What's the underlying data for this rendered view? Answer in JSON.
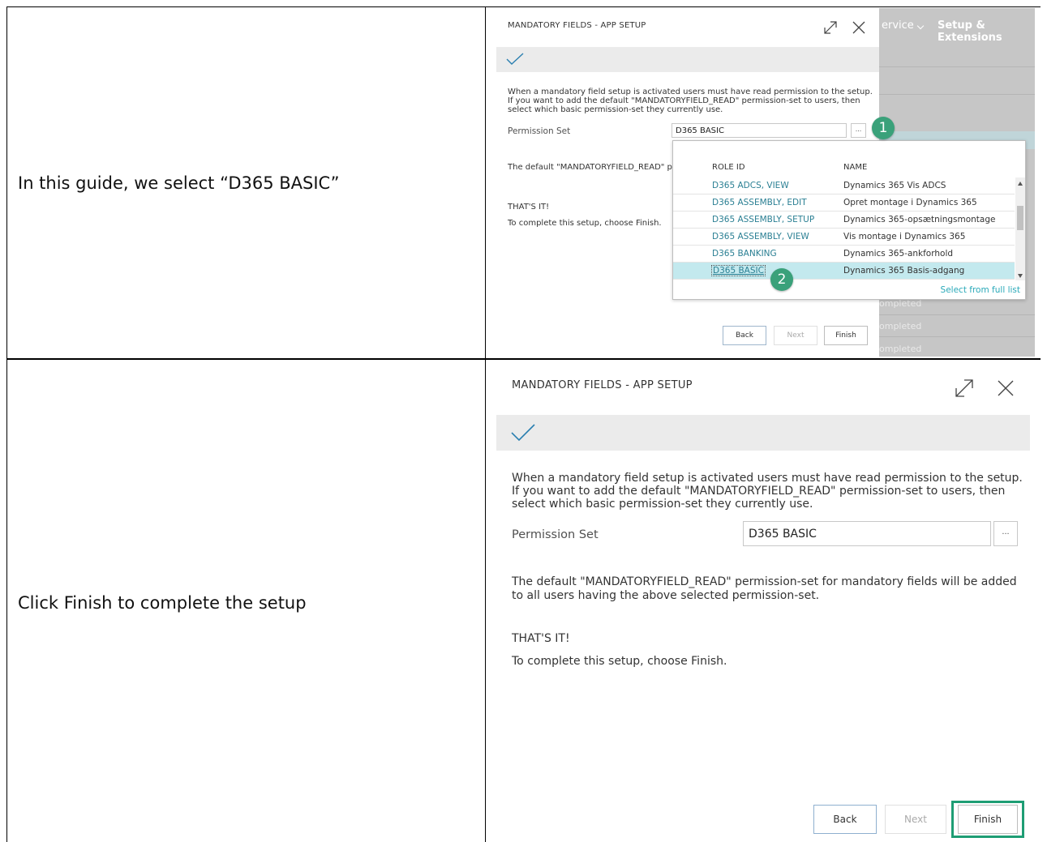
{
  "rows": [
    {
      "instruction": "In this guide, we select “D365 BASIC”"
    },
    {
      "instruction": "Click Finish to complete the setup"
    }
  ],
  "dialog": {
    "title": "MANDATORY FIELDS - APP SETUP",
    "intro_text": "When a mandatory field setup is activated users must have read permission to the setup. If you want to add the default \"MANDATORYFIELD_READ\" permission-set to users, then select which basic permission-set they currently use.",
    "permission_label": "Permission Set",
    "permission_value": "D365 BASIC",
    "lookup_button": "...",
    "default_text": "The default \"MANDATORYFIELD_READ\" permission-set for mandatory fields will be added to all users having the above selected permission-set.",
    "thats_it": "THAT'S IT!",
    "complete_text": "To complete this setup, choose Finish.",
    "buttons": {
      "back": "Back",
      "next": "Next",
      "finish": "Finish"
    }
  },
  "background_page": {
    "nav": [
      "ervice",
      "Setup & Extensions"
    ],
    "status_rows": [
      "ompleted",
      "ompleted",
      "ompleted",
      "ompleted"
    ]
  },
  "dropdown": {
    "headers": {
      "role": "ROLE ID",
      "name": "NAME"
    },
    "rows": [
      {
        "role": "D365 ADCS, VIEW",
        "name": "Dynamics 365 Vis ADCS"
      },
      {
        "role": "D365 ASSEMBLY, EDIT",
        "name": "Opret montage i Dynamics 365"
      },
      {
        "role": "D365 ASSEMBLY, SETUP",
        "name": "Dynamics 365-opsætningsmontage"
      },
      {
        "role": "D365 ASSEMBLY, VIEW",
        "name": "Vis montage i Dynamics 365"
      },
      {
        "role": "D365 BANKING",
        "name": "Dynamics 365-ankforhold"
      },
      {
        "role": "D365 BASIC",
        "name": "Dynamics 365 Basis-adgang"
      }
    ],
    "selected_index": 5,
    "full_list_link": "Select from full list"
  },
  "callouts": [
    "1",
    "2"
  ],
  "colors": {
    "accent": "#2aa9b9",
    "badge": "#3aa17a",
    "selected_row": "#c3e9ee",
    "finish_highlight": "#1e9d74",
    "link": "#2a7f93"
  }
}
